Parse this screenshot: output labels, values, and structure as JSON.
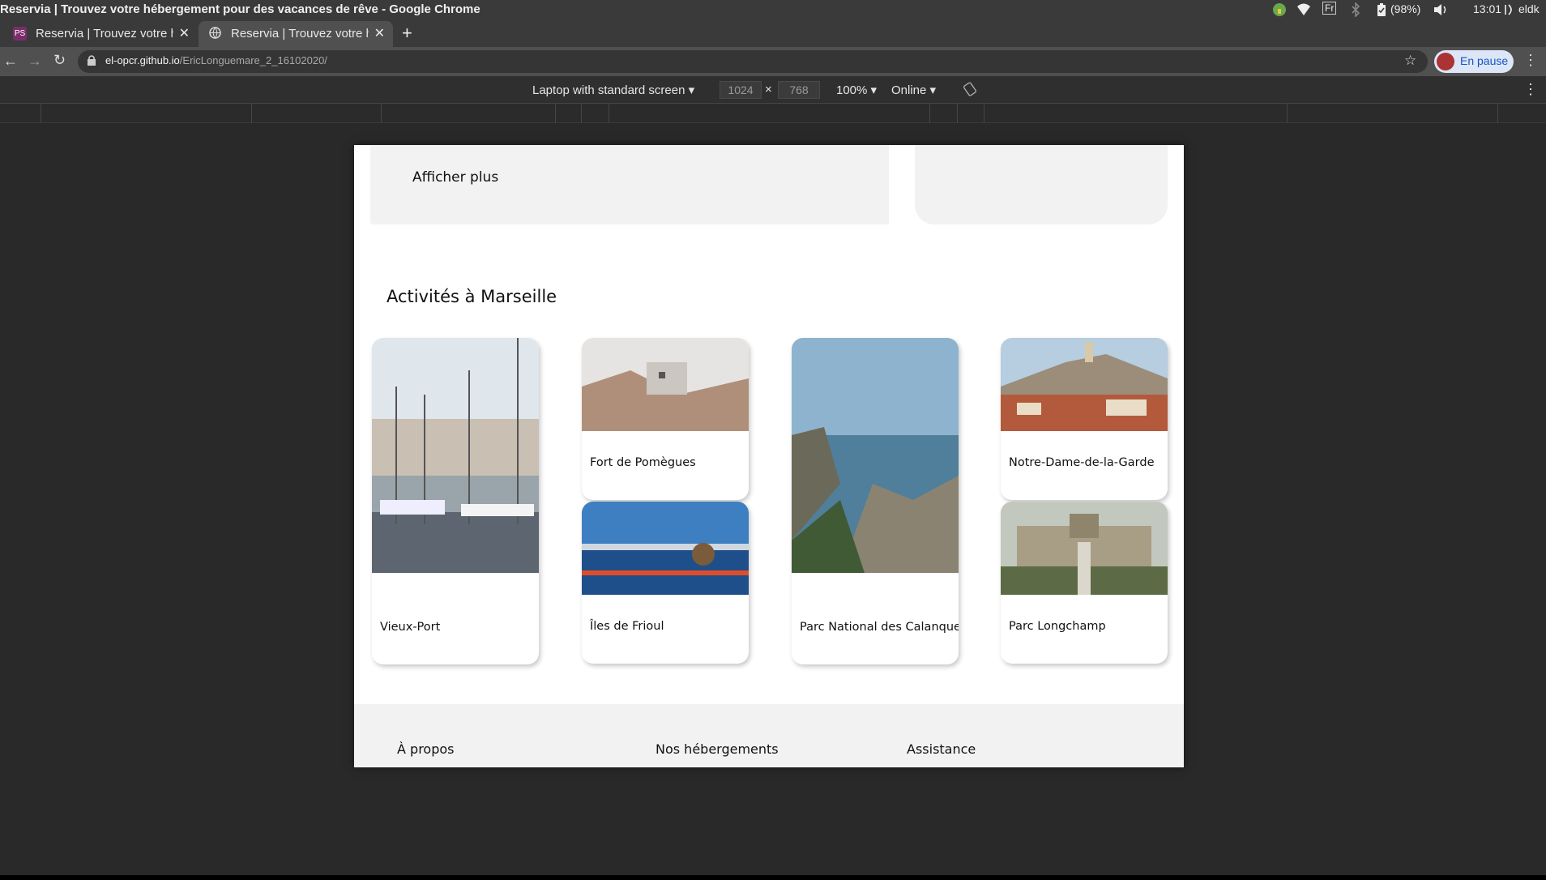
{
  "os": {
    "window_title": "Reservia | Trouvez votre hébergement pour des vacances de rêve - Google Chrome",
    "tray": {
      "lang": "Fr",
      "battery": "(98%)",
      "time": "13:01",
      "user": "eldk"
    }
  },
  "browser": {
    "tabs": [
      {
        "label": "Reservia | Trouvez votre hébergement",
        "icon": "phpstorm-icon",
        "active": false
      },
      {
        "label": "Reservia | Trouvez votre hébergement",
        "icon": "globe-icon",
        "active": true
      }
    ],
    "new_tab": "+",
    "url_host": "el-opcr.github.io",
    "url_path": "/EricLonguemare_2_16102020/",
    "profile_label": "En pause"
  },
  "device_toolbar": {
    "device": "Laptop with standard screen",
    "width": "1024",
    "times": "×",
    "height": "768",
    "zoom": "100%",
    "network": "Online"
  },
  "page": {
    "show_more": "Afficher plus",
    "activities_title": "Activités à Marseille",
    "activities": [
      {
        "caption": "Vieux-Port"
      },
      {
        "caption": "Fort de Pomègues"
      },
      {
        "caption": "Îles de Frioul"
      },
      {
        "caption": "Parc National des Calanques"
      },
      {
        "caption": "Notre-Dame-de-la-Garde"
      },
      {
        "caption": "Parc Longchamp"
      }
    ],
    "footer": {
      "col1": "À propos",
      "col2": "Nos hébergements",
      "col3": "Assistance"
    }
  }
}
